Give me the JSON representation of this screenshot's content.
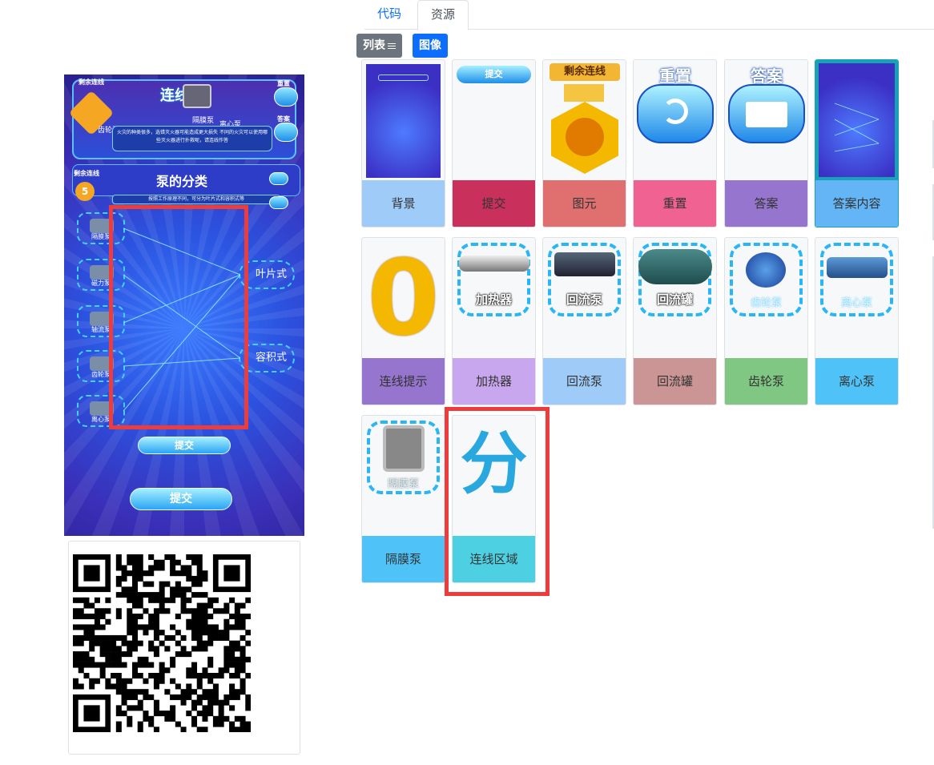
{
  "tabs": [
    {
      "label": "代码",
      "active": false
    },
    {
      "label": "资源",
      "active": true
    }
  ],
  "view_buttons": {
    "list_label": "列表",
    "image_label": "图像"
  },
  "phone": {
    "top_badge": "剩余连线",
    "top_title": "连线",
    "pump_label_1": "隔膜泵",
    "pump_label_2": "离心泵",
    "pump_label_3": "齿轮泵",
    "reset_label": "重置",
    "answer_label": "答案",
    "desc": "火灾的种类很多，选错灭火器可能造成更大损失 不同的火灾可以使用哪些灭火器进行扑救呢，请连线作答",
    "panel_badge": "剩余连线",
    "panel_title": "泵的分类",
    "panel_count": "5",
    "hint": "按照工作原理不同，可分为叶片式和容积式等",
    "nodes": [
      "隔膜泵",
      "磁力泵",
      "轴流泵",
      "齿轮泵",
      "离心泵"
    ],
    "categories": [
      "叶片式",
      "容积式"
    ],
    "inner_submit": "提交",
    "submit": "提交"
  },
  "resources": [
    {
      "label": "背景",
      "color": "#9ecbf7"
    },
    {
      "label": "提交",
      "color": "#c9305c"
    },
    {
      "label": "图元",
      "color": "#e07070"
    },
    {
      "label": "重置",
      "color": "#f06292"
    },
    {
      "label": "答案",
      "color": "#9575cd"
    },
    {
      "label": "答案内容",
      "color": "#64b5f6"
    },
    {
      "label": "连线提示",
      "color": "#9575cd"
    },
    {
      "label": "加热器",
      "color": "#c9a7ef"
    },
    {
      "label": "回流泵",
      "color": "#9ecbf7"
    },
    {
      "label": "回流罐",
      "color": "#cc9595"
    },
    {
      "label": "齿轮泵",
      "color": "#81c784"
    },
    {
      "label": "离心泵",
      "color": "#4fc3f7"
    },
    {
      "label": "隔膜泵",
      "color": "#4fc3f7"
    },
    {
      "label": "连线区域",
      "color": "#4dd0e1"
    }
  ],
  "thumbs": {
    "submit_text": "提交",
    "medal_text": "剩余连线",
    "reset_text": "重置",
    "answer_text": "答案",
    "zero_text": "0",
    "heater_text": "加热器",
    "reflux_pump_text": "回流泵",
    "reflux_tank_text": "回流罐",
    "gear_pump_text": "齿轮泵",
    "centrifugal_text": "离心泵",
    "diaphragm_text": "隔膜泵",
    "fen_text": "分"
  }
}
